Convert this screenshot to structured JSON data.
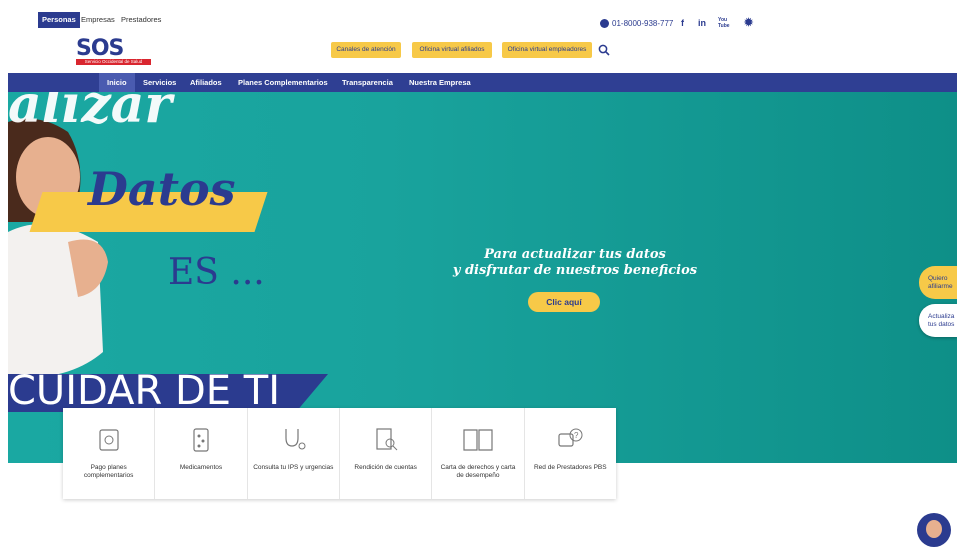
{
  "topbar": {
    "segments": [
      "Personas",
      "Empresas",
      "Prestadores"
    ],
    "phone": "01-8000-938-777",
    "social": [
      "f",
      "in",
      "You Tube"
    ]
  },
  "header": {
    "logo_text": "SOS",
    "logo_sub": "Servicio Occidental de Salud",
    "pills": [
      "Canales de atención",
      "Oficina virtual afiliados",
      "Oficina virtual empleadores"
    ]
  },
  "nav": {
    "items": [
      "Inicio",
      "Servicios",
      "Afiliados",
      "Planes Complementarios",
      "Transparencia",
      "Nuestra Empresa"
    ]
  },
  "hero": {
    "words": [
      "alizar",
      "Datos",
      "ES ...",
      "CUIDAR DE TI"
    ],
    "headline_1": "Para actualizar tus datos",
    "headline_2": "y disfrutar de nuestros beneficios",
    "cta": "Clic aquí"
  },
  "side_buttons": [
    "Quiero afiliarme",
    "Actualiza tus datos"
  ],
  "cards": [
    {
      "label": "Pago planes complementarios",
      "icon": "payment-icon"
    },
    {
      "label": "Medicamentos",
      "icon": "medicine-icon"
    },
    {
      "label": "Consulta tu IPS y urgencias",
      "icon": "stethoscope-icon"
    },
    {
      "label": "Rendición de cuentas",
      "icon": "document-search-icon"
    },
    {
      "label": "Carta de derechos y carta de desempeño",
      "icon": "book-icon"
    },
    {
      "label": "Red de Prestadores PBS",
      "icon": "chat-question-icon"
    }
  ],
  "colors": {
    "brand": "#2f3f93",
    "accent": "#f7c948",
    "hero": "#1aa8a2"
  }
}
